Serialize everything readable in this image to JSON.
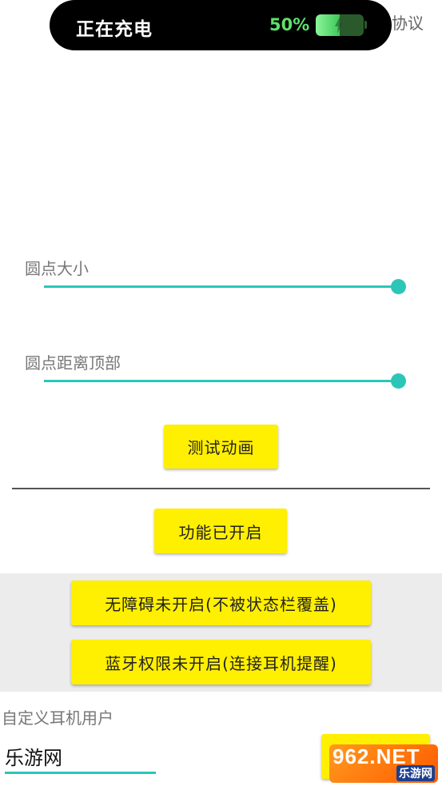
{
  "charging_banner": {
    "status": "正在充电",
    "percent_text": "50%",
    "battery_level": 0.5
  },
  "agreement_link": "协议",
  "sliders": [
    {
      "label": "圆点大小",
      "value_fraction": 1.0
    },
    {
      "label": "圆点距离顶部",
      "value_fraction": 1.0
    }
  ],
  "buttons": {
    "test_animation": "测试动画",
    "feature_enabled": "功能已开启",
    "accessibility": "无障碍未开启(不被状态栏覆盖)",
    "bluetooth": "蓝牙权限未开启(连接耳机提醒)"
  },
  "custom_user": {
    "label": "自定义耳机用户",
    "value": "乐游网"
  },
  "watermark": {
    "big": "962.NET",
    "small": "乐游网"
  },
  "colors": {
    "accent": "#2bc6b8",
    "button": "#ffef00",
    "charging_text": "#5ee06a"
  }
}
